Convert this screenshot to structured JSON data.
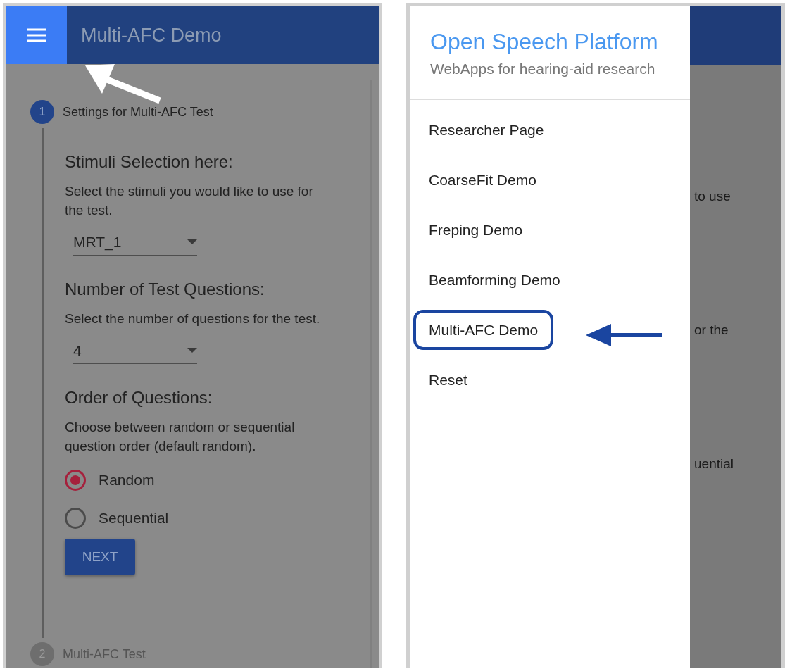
{
  "left_screen": {
    "app_bar": {
      "title": "Multi-AFC Demo"
    },
    "steps": [
      {
        "number": "1",
        "label": "Settings for Multi-AFC Test",
        "active": true
      },
      {
        "number": "2",
        "label": "Multi-AFC Test",
        "active": false
      }
    ],
    "sections": [
      {
        "kind": "select",
        "heading": "Stimuli Selection here:",
        "description": "Select the stimuli you would like to use for the test.",
        "value": "MRT_1"
      },
      {
        "kind": "select",
        "heading": "Number of Test Questions:",
        "description": "Select the number of questions for the test.",
        "value": "4"
      },
      {
        "kind": "radio",
        "heading": "Order of Questions:",
        "description": "Choose between random or sequential question order (default random).",
        "options": [
          {
            "label": "Random",
            "selected": true
          },
          {
            "label": "Sequential",
            "selected": false
          }
        ]
      }
    ],
    "button": "NEXT"
  },
  "right_screen": {
    "drawer": {
      "title": "Open Speech Platform",
      "subtitle": "WebApps for hearing-aid research",
      "items": [
        {
          "label": "Researcher Page",
          "highlighted": false
        },
        {
          "label": "CoarseFit Demo",
          "highlighted": false
        },
        {
          "label": "Freping Demo",
          "highlighted": false
        },
        {
          "label": "Beamforming Demo",
          "highlighted": false
        },
        {
          "label": "Multi-AFC Demo",
          "highlighted": true
        },
        {
          "label": "Reset",
          "highlighted": false
        }
      ]
    },
    "background_fragments": [
      "to use",
      "or the",
      "uential"
    ]
  }
}
